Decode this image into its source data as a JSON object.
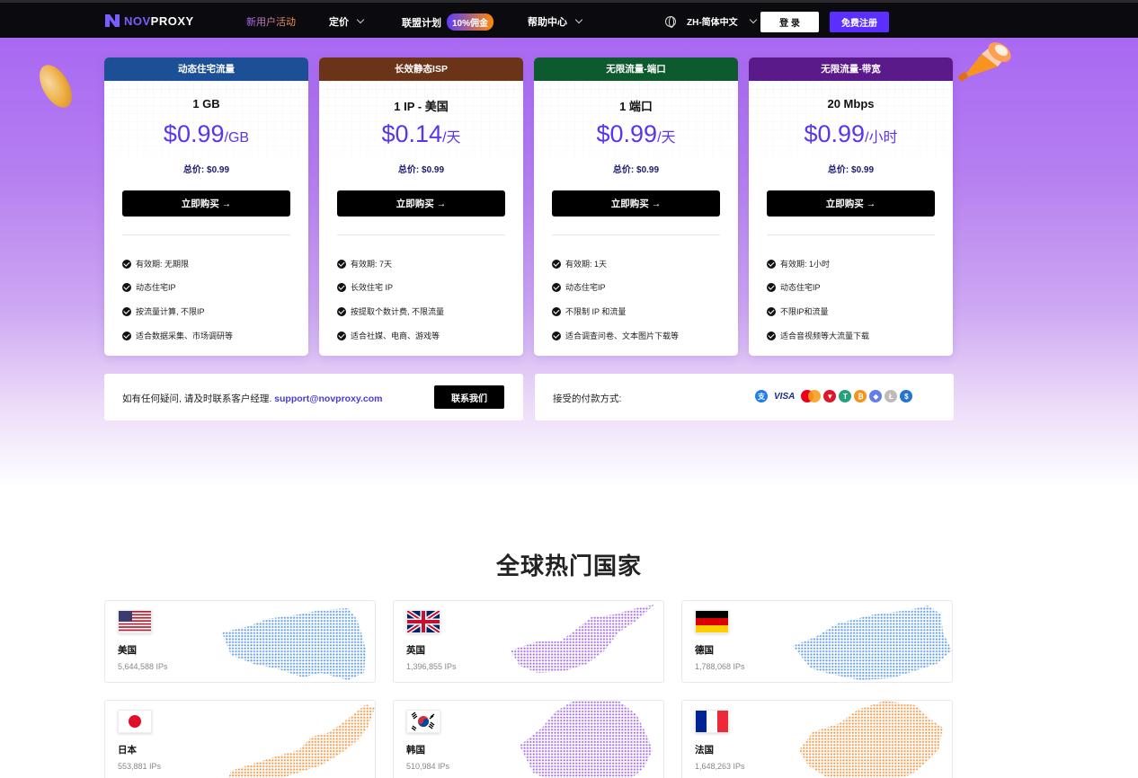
{
  "nav": {
    "brand_nov": "NOV",
    "brand_proxy": "PROXY",
    "promo": "新用户活动",
    "pricing": "定价",
    "affiliate": "联盟计划",
    "affiliate_badge": "10%佣金",
    "help": "帮助中心",
    "language": "ZH-简体中文",
    "login": "登 录",
    "signup": "免费注册"
  },
  "plans": [
    {
      "header": "动态住宅流量",
      "header_color": "#1d4f96",
      "name": "1 GB",
      "price": "$0.99",
      "unit": "/GB",
      "total": "总价: $0.99",
      "buy": "立即购买 →",
      "features": [
        "有效期: 无期限",
        "动态住宅IP",
        "按流量计算, 不限IP",
        "适合数据采集、市场调研等"
      ]
    },
    {
      "header": "长效静态ISP",
      "header_color": "#6b3418",
      "name": "1 IP - 美国",
      "price": "$0.14",
      "unit": "/天",
      "total": "总价: $0.99",
      "buy": "立即购买 →",
      "features": [
        "有效期: 7天",
        "长效住宅 IP",
        "按提取个数计费, 不限流量",
        "适合社媒、电商、游戏等"
      ]
    },
    {
      "header": "无限流量-端口",
      "header_color": "#0d5a2e",
      "name": "1 端口",
      "price": "$0.99",
      "unit": "/天",
      "total": "总价: $0.99",
      "buy": "立即购买 →",
      "features": [
        "有效期: 1天",
        "动态住宅IP",
        "不限制 IP 和流量",
        "适合调查问卷、文本图片下载等"
      ]
    },
    {
      "header": "无限流量-带宽",
      "header_color": "#5b1a8a",
      "name": "20 Mbps",
      "price": "$0.99",
      "unit": "/小时",
      "total": "总价: $0.99",
      "buy": "立即购买 →",
      "features": [
        "有效期: 1小时",
        "动态住宅IP",
        "不限IP和流量",
        "适合音视频等大流量下载"
      ]
    }
  ],
  "support": {
    "text": "如有任何疑问, 请及时联系客户经理. ",
    "email": "support@novproxy.com",
    "button": "联系我们"
  },
  "payment": {
    "label": "接受的付款方式:",
    "visa": "VISA",
    "icons": [
      "alipay-icon",
      "visa-icon",
      "mastercard-icon",
      "tron-icon",
      "tether-icon",
      "bitcoin-icon",
      "ethereum-icon",
      "litecoin-icon",
      "usdc-icon"
    ]
  },
  "countries_title": "全球热门国家",
  "countries": [
    {
      "name": "美国",
      "ips": "5,644,588 IPs",
      "flag": "us-flag-icon",
      "map_color": "#4a8fe6"
    },
    {
      "name": "英国",
      "ips": "1,396,855 IPs",
      "flag": "uk-flag-icon",
      "map_color": "#9a5ae6"
    },
    {
      "name": "德国",
      "ips": "1,788,068 IPs",
      "flag": "de-flag-icon",
      "map_color": "#4a8fe6"
    },
    {
      "name": "日本",
      "ips": "553,881 IPs",
      "flag": "jp-flag-icon",
      "map_color": "#f28a2e"
    },
    {
      "name": "韩国",
      "ips": "510,984 IPs",
      "flag": "kr-flag-icon",
      "map_color": "#9a5ae6"
    },
    {
      "name": "法国",
      "ips": "1,648,263 IPs",
      "flag": "fr-flag-icon",
      "map_color": "#f28a2e"
    }
  ]
}
